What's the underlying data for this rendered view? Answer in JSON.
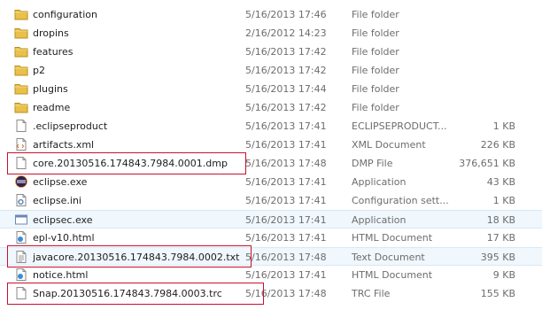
{
  "files": [
    {
      "name": "configuration",
      "date": "5/16/2013 17:46",
      "type": "File folder",
      "size": "",
      "icon": "folder-icon"
    },
    {
      "name": "dropins",
      "date": "2/16/2012 14:23",
      "type": "File folder",
      "size": "",
      "icon": "folder-icon"
    },
    {
      "name": "features",
      "date": "5/16/2013 17:42",
      "type": "File folder",
      "size": "",
      "icon": "folder-icon"
    },
    {
      "name": "p2",
      "date": "5/16/2013 17:42",
      "type": "File folder",
      "size": "",
      "icon": "folder-icon"
    },
    {
      "name": "plugins",
      "date": "5/16/2013 17:44",
      "type": "File folder",
      "size": "",
      "icon": "folder-icon"
    },
    {
      "name": "readme",
      "date": "5/16/2013 17:42",
      "type": "File folder",
      "size": "",
      "icon": "folder-icon"
    },
    {
      "name": ".eclipseproduct",
      "date": "5/16/2013 17:41",
      "type": "ECLIPSEPRODUCT...",
      "size": "1 KB",
      "icon": "blank-file-icon"
    },
    {
      "name": "artifacts.xml",
      "date": "5/16/2013 17:41",
      "type": "XML Document",
      "size": "226 KB",
      "icon": "xml-file-icon"
    },
    {
      "name": "core.20130516.174843.7984.0001.dmp",
      "date": "5/16/2013 17:48",
      "type": "DMP File",
      "size": "376,651 KB",
      "icon": "blank-file-icon"
    },
    {
      "name": "eclipse.exe",
      "date": "5/16/2013 17:41",
      "type": "Application",
      "size": "43 KB",
      "icon": "eclipse-app-icon"
    },
    {
      "name": "eclipse.ini",
      "date": "5/16/2013 17:41",
      "type": "Configuration sett...",
      "size": "1 KB",
      "icon": "settings-file-icon"
    },
    {
      "name": "eclipsec.exe",
      "date": "5/16/2013 17:41",
      "type": "Application",
      "size": "18 KB",
      "icon": "console-app-icon"
    },
    {
      "name": "epl-v10.html",
      "date": "5/16/2013 17:41",
      "type": "HTML Document",
      "size": "17 KB",
      "icon": "html-file-icon"
    },
    {
      "name": "javacore.20130516.174843.7984.0002.txt",
      "date": "5/16/2013 17:48",
      "type": "Text Document",
      "size": "395 KB",
      "icon": "text-file-icon"
    },
    {
      "name": "notice.html",
      "date": "5/16/2013 17:41",
      "type": "HTML Document",
      "size": "9 KB",
      "icon": "html-file-icon"
    },
    {
      "name": "Snap.20130516.174843.7984.0003.trc",
      "date": "5/16/2013 17:48",
      "type": "TRC File",
      "size": "155 KB",
      "icon": "blank-file-icon"
    }
  ],
  "selected_rows": [
    11,
    13
  ],
  "highlighted_rows": [
    8,
    13,
    15
  ],
  "colors": {
    "highlight_box": "#c8102e",
    "selection_bg": "#f0f7fd",
    "folder": "#e8c04a"
  }
}
